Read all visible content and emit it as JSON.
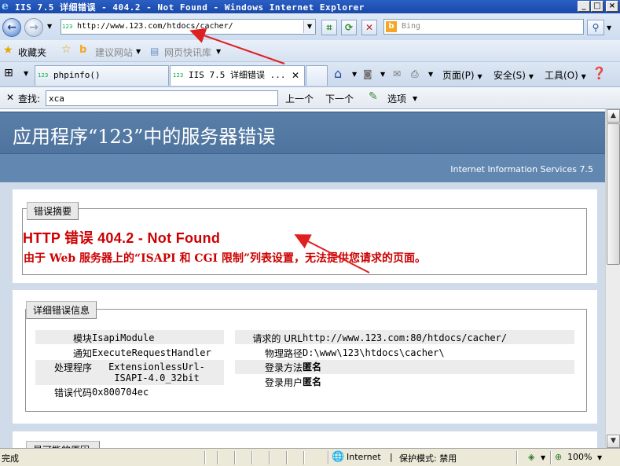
{
  "window": {
    "title": "IIS 7.5 详细错误 - 404.2 - Not Found - Windows Internet Explorer"
  },
  "address_bar": {
    "url": "http://www.123.com/htdocs/cacher/",
    "search_placeholder": "Bing"
  },
  "favorites_bar": {
    "favorites_label": "收藏夹",
    "suggested_sites": "建议网站",
    "web_slice": "网页快讯库"
  },
  "tabs": [
    {
      "label": "phpinfo()"
    },
    {
      "label": "IIS 7.5 详细错误 ..."
    }
  ],
  "command_bar": {
    "page": "页面(P)",
    "safety": "安全(S)",
    "tools": "工具(O)"
  },
  "find_bar": {
    "label": "查找:",
    "query": "xca",
    "prev": "上一个",
    "next": "下一个",
    "options": "选项"
  },
  "page": {
    "heading": "应用程序“123”中的服务器错误",
    "server_name": "Internet Information Services 7.5",
    "summary_legend": "错误摘要",
    "error_title": "HTTP 错误 404.2 - Not Found",
    "error_description": "由于 Web 服务器上的“ISAPI 和 CGI 限制”列表设置，无法提供您请求的页面。",
    "details_legend": "详细错误信息",
    "details_left": [
      {
        "label": "模块",
        "value": "IsapiModule"
      },
      {
        "label": "通知",
        "value": "ExecuteRequestHandler"
      },
      {
        "label": "处理程序",
        "value": "ExtensionlessUrl-ISAPI-4.0_32bit"
      },
      {
        "label": "错误代码",
        "value": "0x800704ec"
      }
    ],
    "details_right": [
      {
        "label": "请求的 URL",
        "value": "http://www.123.com:80/htdocs/cacher/"
      },
      {
        "label": "物理路径",
        "value": "D:\\www\\123\\htdocs\\cacher\\"
      },
      {
        "label": "登录方法",
        "value": "匿名"
      },
      {
        "label": "登录用户",
        "value": "匿名"
      }
    ],
    "causes_legend": "最可能的原因:"
  },
  "status_bar": {
    "status": "完成",
    "zone": "Internet",
    "protected_mode": "保护模式: 禁用",
    "zoom": "100%"
  },
  "colors": {
    "error_red": "#cc0000",
    "banner_blue": "#4f769f",
    "annotation_arrow": "#e02020"
  }
}
